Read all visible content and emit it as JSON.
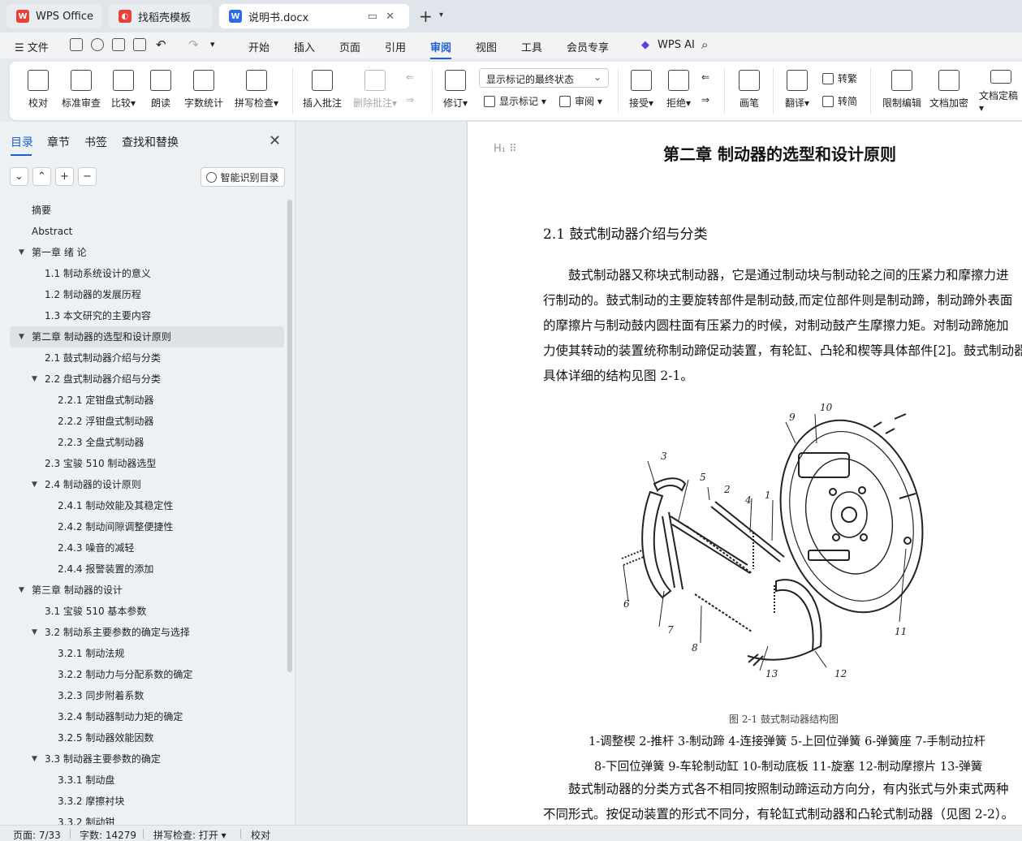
{
  "tabs": {
    "wps": "WPS Office",
    "template": "找稻壳模板",
    "doc": "说明书.docx"
  },
  "menu": {
    "file": "文件",
    "items": [
      "开始",
      "插入",
      "页面",
      "引用",
      "审阅",
      "视图",
      "工具",
      "会员专享"
    ],
    "ai": "WPS AI"
  },
  "ribbon": {
    "proofread": "校对",
    "standard_review": "标准审查",
    "compare": "比较",
    "read_aloud": "朗读",
    "word_count": "字数统计",
    "spell_check": "拼写检查",
    "insert_comment": "插入批注",
    "delete_comment": "删除批注",
    "revise": "修订",
    "display_select": "显示标记的最终状态",
    "show_markup": "显示标记",
    "review": "审阅",
    "accept": "接受",
    "reject": "拒绝",
    "pen": "画笔",
    "translate": "翻译",
    "to_traditional": "转繁",
    "to_simplified": "转简",
    "restrict_edit": "限制编辑",
    "encrypt": "文档加密",
    "finalize": "文档定稿"
  },
  "sidebar": {
    "tabs": [
      "目录",
      "章节",
      "书签",
      "查找和替换"
    ],
    "smart_toc": "智能识别目录",
    "toc": [
      {
        "label": "摘要",
        "level": 1,
        "arrow": false
      },
      {
        "label": "Abstract",
        "level": 1,
        "arrow": false
      },
      {
        "label": "第一章 绪  论",
        "level": 1,
        "arrow": true
      },
      {
        "label": "1.1 制动系统设计的意义",
        "level": 2,
        "arrow": false
      },
      {
        "label": "1.2 制动器的发展历程",
        "level": 2,
        "arrow": false
      },
      {
        "label": "1.3 本文研究的主要内容",
        "level": 2,
        "arrow": false
      },
      {
        "label": "第二章  制动器的选型和设计原则",
        "level": 1,
        "arrow": true,
        "selected": true
      },
      {
        "label": "2.1 鼓式制动器介绍与分类",
        "level": 2,
        "arrow": false
      },
      {
        "label": "2.2 盘式制动器介绍与分类",
        "level": 2,
        "arrow": true
      },
      {
        "label": "2.2.1 定钳盘式制动器",
        "level": 3,
        "arrow": false
      },
      {
        "label": "2.2.2 浮钳盘式制动器",
        "level": 3,
        "arrow": false
      },
      {
        "label": "2.2.3 全盘式制动器",
        "level": 3,
        "arrow": false
      },
      {
        "label": "2.3 宝骏 510 制动器选型",
        "level": 2,
        "arrow": false
      },
      {
        "label": "2.4 制动器的设计原则",
        "level": 2,
        "arrow": true
      },
      {
        "label": "2.4.1 制动效能及其稳定性",
        "level": 3,
        "arrow": false
      },
      {
        "label": "2.4.2 制动间隙调整便捷性",
        "level": 3,
        "arrow": false
      },
      {
        "label": "2.4.3 噪音的减轻",
        "level": 3,
        "arrow": false
      },
      {
        "label": "2.4.4 报警装置的添加",
        "level": 3,
        "arrow": false
      },
      {
        "label": "第三章 制动器的设计",
        "level": 1,
        "arrow": true
      },
      {
        "label": "3.1 宝骏 510 基本参数",
        "level": 2,
        "arrow": false
      },
      {
        "label": "3.2 制动系主要参数的确定与选择",
        "level": 2,
        "arrow": true
      },
      {
        "label": "3.2.1 制动法规",
        "level": 3,
        "arrow": false
      },
      {
        "label": "3.2.2 制动力与分配系数的确定",
        "level": 3,
        "arrow": false
      },
      {
        "label": "3.2.3 同步附着系数",
        "level": 3,
        "arrow": false
      },
      {
        "label": "3.2.4 制动器制动力矩的确定",
        "level": 3,
        "arrow": false
      },
      {
        "label": "3.2.5 制动器效能因数",
        "level": 3,
        "arrow": false
      },
      {
        "label": "3.3 制动器主要参数的确定",
        "level": 2,
        "arrow": true
      },
      {
        "label": "3.3.1 制动盘",
        "level": 3,
        "arrow": false
      },
      {
        "label": "3.3.2 摩擦衬块",
        "level": 3,
        "arrow": false
      },
      {
        "label": "3.3.2 制动钳",
        "level": 3,
        "arrow": false
      }
    ]
  },
  "document": {
    "chapter_title": "第二章  制动器的选型和设计原则",
    "section_title": "2.1 鼓式制动器介绍与分类",
    "para1": [
      "　　鼓式制动器又称块式制动器，它是通过制动块与制动轮之间的压紧力和摩擦力进",
      "行制动的。鼓式制动的主要旋转部件是制动鼓,而定位部件则是制动蹄，制动蹄外表面",
      "的摩擦片与制动鼓内圆柱面有压紧力的时候，对制动鼓产生摩擦力矩。对制动蹄施加",
      "力使其转动的装置统称制动蹄促动装置，有轮缸、凸轮和楔等具体部件[2]。鼓式制动器",
      "具体详细的结构见图 2-1。"
    ],
    "figure_labels": [
      "1",
      "2",
      "3",
      "4",
      "5",
      "6",
      "7",
      "8",
      "9",
      "10",
      "11",
      "12",
      "13"
    ],
    "figure_caption": "图 2-1 鼓式制动器结构图",
    "legend_line1": "1-调整楔 2-推杆 3-制动蹄 4-连接弹簧 5-上回位弹簧 6-弹簧座 7-手制动拉杆",
    "legend_line2": "8-下回位弹簧 9-车轮制动缸 10-制动底板 11-旋塞 12-制动摩擦片 13-弹簧",
    "para2": [
      "　　鼓式制动器的分类方式各不相同按照制动蹄运动方向分，有内张式与外束式两种",
      "不同形式。按促动装置的形式不同分，有轮缸式制动器和凸轮式制动器（见图 2-2）。"
    ]
  },
  "status": {
    "page": "页面: 7/33",
    "words": "字数: 14279",
    "spell": "拼写检查: 打开",
    "proof": "校对"
  }
}
